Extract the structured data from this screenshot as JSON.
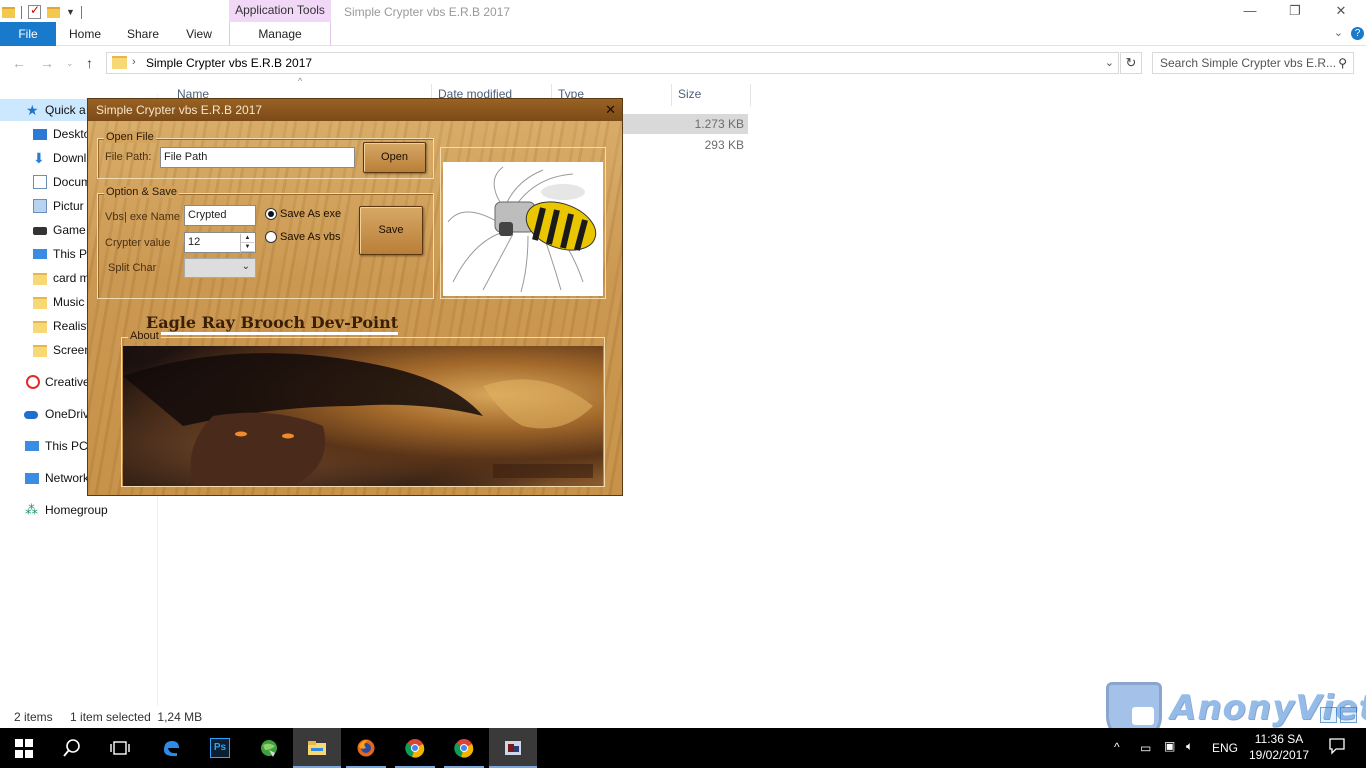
{
  "explorer": {
    "window_title": "Simple Crypter vbs E.R.B 2017",
    "context_tab": "Application Tools",
    "ribbon_tabs": [
      "File",
      "Home",
      "Share",
      "View",
      "Manage"
    ],
    "address_path": "Simple Crypter vbs E.R.B 2017",
    "search_placeholder": "Search Simple Crypter vbs E.R...",
    "columns": [
      "Name",
      "Date modified",
      "Type",
      "Size"
    ],
    "file_sizes": [
      "1.273 KB",
      "293 KB"
    ],
    "nav_items": [
      "Quick a",
      "Deskto",
      "Downl",
      "Docum",
      "Pictur",
      "Game",
      "This P",
      "card m",
      "Music",
      "Realist",
      "Screen",
      "Creative",
      "OneDriv",
      "This PC",
      "Network",
      "Homegroup"
    ],
    "status": {
      "items": "2 items",
      "selected": "1 item selected  1,24 MB"
    }
  },
  "crypter": {
    "title": "Simple Crypter vbs E.R.B 2017",
    "open_group": "Open File",
    "file_path_label": "File Path:",
    "file_path_value": "File Path",
    "open_button": "Open",
    "option_group": "Option & Save",
    "exe_name_label": "Vbs| exe Name",
    "exe_name_value": "Crypted",
    "crypter_value_label": "Crypter value",
    "crypter_value": "12",
    "split_char_label": "Split Char",
    "radio_exe": "Save As exe",
    "radio_vbs": "Save As vbs",
    "save_button": "Save",
    "heading": "Eagle Ray Brooch Dev-Point",
    "about_group": "About"
  },
  "watermark": {
    "text": "AnonyViet"
  },
  "taskbar": {
    "language": "ENG",
    "time": "11:36 SA",
    "date": "19/02/2017"
  },
  "colors": {
    "accent": "#1979ca",
    "wood": "#c9964f",
    "context_tab": "#f2d8f7"
  }
}
